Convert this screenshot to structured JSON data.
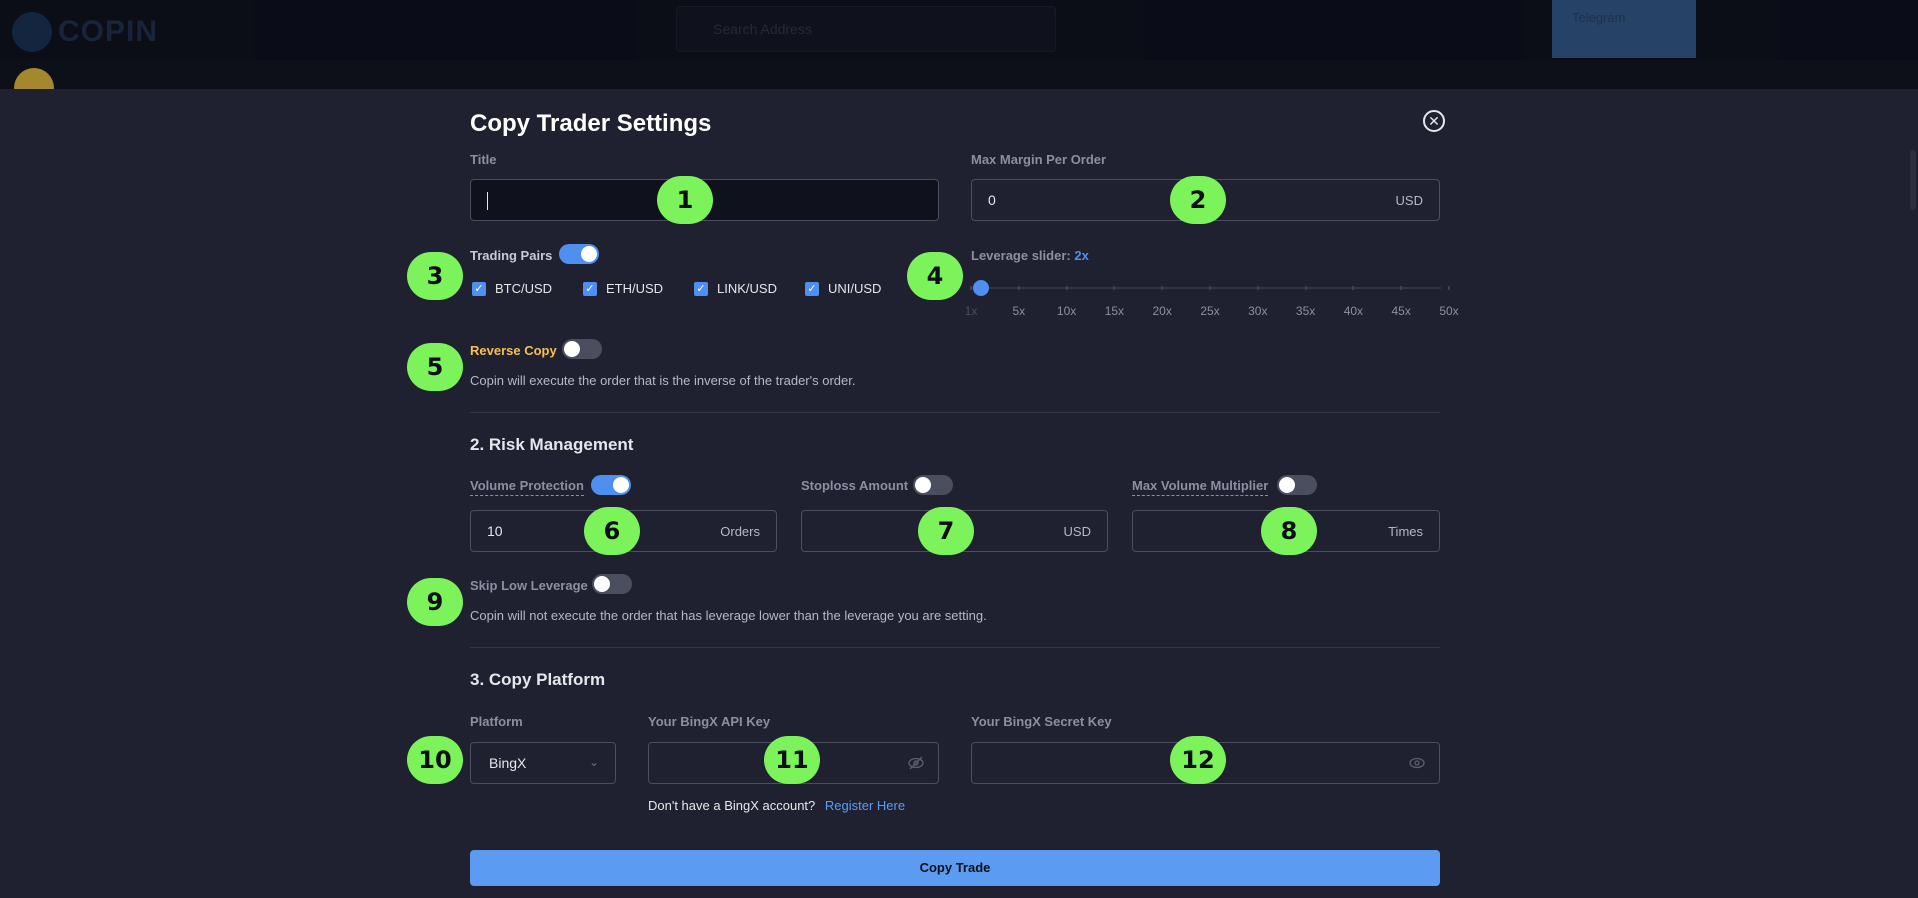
{
  "background": {
    "logo_text": "COPIN",
    "search_placeholder": "Search Address",
    "telegram_button": "Telegram"
  },
  "modal": {
    "title": "Copy Trader Settings",
    "title_field": {
      "label": "Title",
      "value": ""
    },
    "max_margin": {
      "label": "Max Margin Per Order",
      "value": "0",
      "unit": "USD"
    },
    "trading_pairs": {
      "label": "Trading Pairs",
      "enabled": true,
      "pairs": [
        {
          "label": "BTC/USD",
          "checked": true
        },
        {
          "label": "ETH/USD",
          "checked": true
        },
        {
          "label": "LINK/USD",
          "checked": true
        },
        {
          "label": "UNI/USD",
          "checked": true
        }
      ]
    },
    "leverage": {
      "label": "Leverage slider:",
      "value_text": "2x",
      "value": 2,
      "ticks": [
        "1x",
        "5x",
        "10x",
        "15x",
        "20x",
        "25x",
        "30x",
        "35x",
        "40x",
        "45x",
        "50x"
      ]
    },
    "reverse_copy": {
      "label": "Reverse Copy",
      "enabled": false,
      "description": "Copin will execute the order that is the inverse of the trader's order."
    },
    "risk": {
      "title": "2. Risk Management",
      "volume_protection": {
        "label": "Volume Protection",
        "enabled": true,
        "value": "10",
        "unit": "Orders"
      },
      "stoploss": {
        "label": "Stoploss Amount",
        "enabled": false,
        "value": "",
        "unit": "USD"
      },
      "max_volume_multiplier": {
        "label": "Max Volume Multiplier",
        "enabled": false,
        "value": "",
        "unit": "Times"
      },
      "skip_low_leverage": {
        "label": "Skip Low Leverage",
        "enabled": false,
        "description": "Copin will not execute the order that has leverage lower than the leverage you are setting."
      }
    },
    "platform_section": {
      "title": "3. Copy Platform",
      "platform": {
        "label": "Platform",
        "value": "BingX"
      },
      "api_key": {
        "label": "Your BingX API Key",
        "value": ""
      },
      "secret_key": {
        "label": "Your BingX Secret Key",
        "value": ""
      },
      "no_account_text": "Don't have a BingX account?",
      "register_link": "Register Here"
    },
    "submit_label": "Copy Trade"
  },
  "badges": [
    "1",
    "2",
    "3",
    "4",
    "5",
    "6",
    "7",
    "8",
    "9",
    "10",
    "11",
    "12"
  ],
  "colors": {
    "accent": "#4e8ff0",
    "button": "#5b9cf2",
    "badge": "#7cf25b",
    "warning_label": "#f5c04e"
  }
}
